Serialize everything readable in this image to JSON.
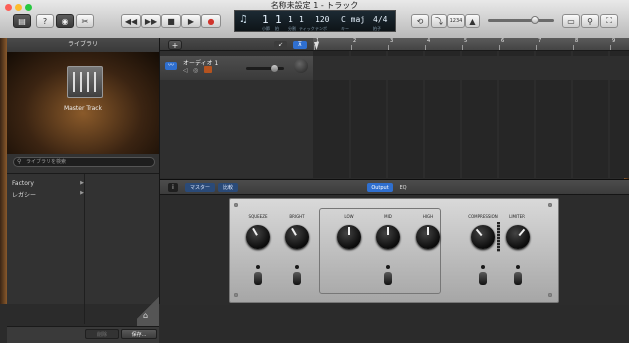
{
  "window": {
    "title": "名称未設定 1 - トラック"
  },
  "lcd": {
    "bar": "1",
    "beat": "1",
    "div": "1",
    "tick": "1",
    "tempo": "120",
    "key": "C maj",
    "signature": "4/4",
    "labels": [
      "小節",
      "拍",
      "分割",
      "ティック",
      "テンポ",
      "キー",
      "拍子"
    ]
  },
  "toolbar": {
    "count_in": "1234"
  },
  "library": {
    "title": "ライブラリ",
    "preset_image_caption": "Master Track",
    "search_placeholder": "ライブラリを検索",
    "categories": [
      {
        "label": "Factory"
      },
      {
        "label": "レガシー"
      }
    ],
    "delete_label": "削除",
    "save_label": "保存..."
  },
  "track": {
    "name": "オーディオ 1"
  },
  "ruler": {
    "bars": [
      "1",
      "2",
      "3",
      "4",
      "5",
      "6",
      "7",
      "8",
      "9"
    ]
  },
  "smart_controls": {
    "tab_master": "マスター",
    "tab_compare": "比較",
    "tab_output": "Output",
    "tab_eq": "EQ",
    "knobs": [
      {
        "label": "SQUEEZE"
      },
      {
        "label": "BRIGHT"
      },
      {
        "label": "LOW"
      },
      {
        "label": "MID"
      },
      {
        "label": "HIGH"
      },
      {
        "label": "COMPRESSION"
      },
      {
        "label": "LIMITER"
      }
    ]
  },
  "colors": {
    "accent": "#2f6fcf",
    "record": "#d0342c",
    "lcd_bg": "#101a20"
  }
}
